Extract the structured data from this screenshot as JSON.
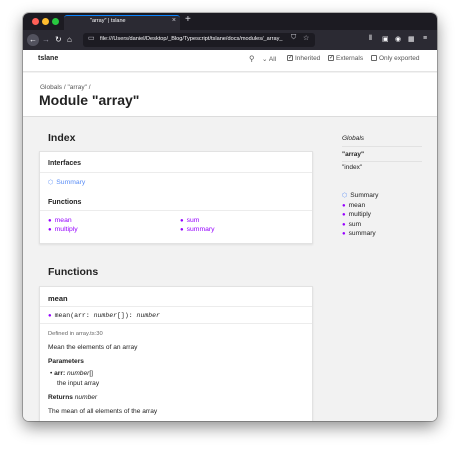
{
  "browser": {
    "tab_title": "\"array\" | tslane",
    "tab_close": "×",
    "new_tab": "+",
    "url": "file:///Users/daniel/Desktop/_Blog/Typescript/tslane/docs/modules/_array_",
    "icons": {
      "back": "back-arrow-icon",
      "forward": "forward-arrow-icon",
      "reload": "reload-icon",
      "home": "home-icon",
      "page": "page-icon",
      "shield": "shield-icon",
      "star": "star-icon",
      "library": "library-icon",
      "sidebar": "sidebar-icon",
      "account": "account-icon",
      "menu": "hamburger-menu-icon"
    },
    "accent": "#0a84ff"
  },
  "header": {
    "brand": "tslane",
    "search_glyph": "⚲",
    "visibility": "All",
    "inherited_label": "Inherited",
    "inherited_checked": true,
    "externals_label": "Externals",
    "externals_checked": true,
    "only_exported_label": "Only exported",
    "only_exported_checked": false
  },
  "title_area": {
    "breadcrumb_globals": "Globals",
    "breadcrumb_sep": " / ",
    "breadcrumb_module": "\"array\"",
    "breadcrumb_end": " /",
    "module_title": "Module \"array\""
  },
  "index": {
    "heading": "Index",
    "interfaces_title": "Interfaces",
    "interfaces": [
      {
        "label": "Summary"
      }
    ],
    "functions_title": "Functions",
    "functions": [
      {
        "label": "mean"
      },
      {
        "label": "multiply"
      },
      {
        "label": "sum"
      },
      {
        "label": "summary"
      }
    ]
  },
  "functions_section": {
    "heading": "Functions",
    "mean": {
      "name": "mean",
      "sig_name": "mean",
      "sig_open": "(arr: ",
      "sig_type": "number",
      "sig_close": "[]): ",
      "sig_return": "number",
      "defined_in": "Defined in array.ts:30",
      "description": "Mean the elements of an array",
      "parameters_title": "Parameters",
      "param_name": "arr:",
      "param_type": "number",
      "param_suffix": "[]",
      "param_desc": "the input array",
      "returns_label": "Returns",
      "returns_type": "number",
      "returns_desc": "The mean of all elements of the array"
    }
  },
  "sidebar": {
    "globals": "Globals",
    "current_module": "\"array\"",
    "other_module": "\"index\"",
    "items": [
      {
        "label": "Summary",
        "kind": "interface"
      },
      {
        "label": "mean",
        "kind": "function"
      },
      {
        "label": "multiply",
        "kind": "function"
      },
      {
        "label": "sum",
        "kind": "function"
      },
      {
        "label": "summary",
        "kind": "function"
      }
    ]
  },
  "colors": {
    "function_link": "#9600ff",
    "interface_link": "#598df6",
    "background": "#f2f2f2"
  }
}
